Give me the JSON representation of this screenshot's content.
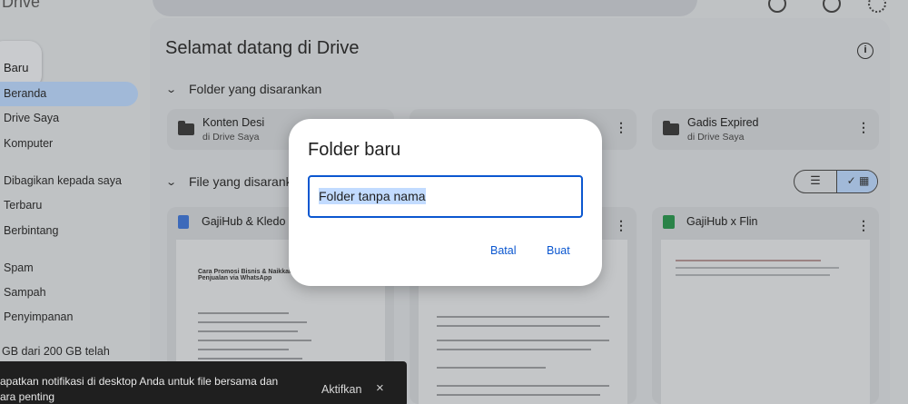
{
  "app": {
    "logo_text": "Drive"
  },
  "sidebar": {
    "new_button": "Baru",
    "items": [
      {
        "label": "Beranda",
        "active": true
      },
      {
        "label": "Drive Saya"
      },
      {
        "label": "Komputer"
      },
      {
        "label": "Dibagikan kepada saya"
      },
      {
        "label": "Terbaru"
      },
      {
        "label": "Berbintang"
      },
      {
        "label": "Spam"
      },
      {
        "label": "Sampah"
      },
      {
        "label": "Penyimpanan"
      }
    ],
    "storage_text": "GB dari 200 GB telah"
  },
  "main": {
    "welcome": "Selamat datang di Drive",
    "suggested_folders_title": "Folder yang disarankan",
    "folders": [
      {
        "name": "Konten Desi",
        "location": "di Drive Saya"
      },
      {
        "name": "",
        "location": ""
      },
      {
        "name": "Gadis Expired",
        "location": "di Drive Saya"
      }
    ],
    "suggested_files_title": "File yang disarankan",
    "files": [
      {
        "title": "GajiHub & Kledo",
        "type": "doc",
        "doc_heading": "Cara Promosi Bisnis & Naikkan Penjualan via WhatsApp"
      },
      {
        "title": "",
        "type": "doc",
        "doc_heading": ""
      },
      {
        "title": "GajiHub x Flin",
        "type": "sheet"
      }
    ]
  },
  "toast": {
    "message": "apatkan notifikasi di desktop Anda untuk file bersama dan ara penting",
    "action": "Aktifkan",
    "close_icon": "×"
  },
  "dialog": {
    "title": "Folder baru",
    "input_value": "Folder tanpa nama",
    "cancel_label": "Batal",
    "create_label": "Buat"
  },
  "colors": {
    "accent": "#0b57d0",
    "selection": "#c2dbff",
    "active_nav": "#a9c3e4",
    "toast_bg": "#1f1f1f"
  }
}
